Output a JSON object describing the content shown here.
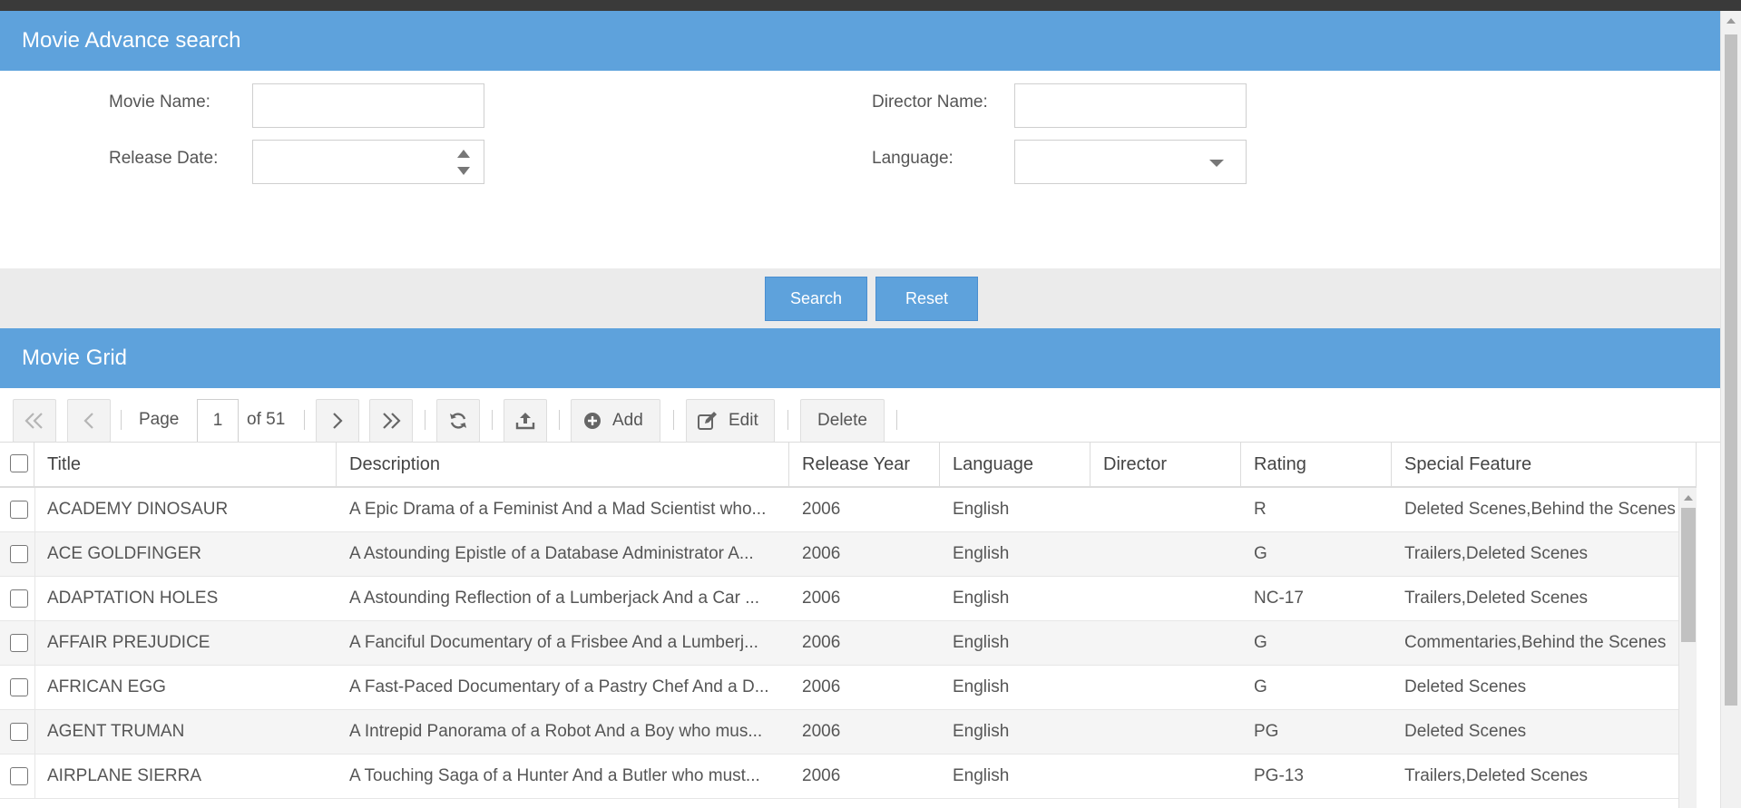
{
  "search_panel": {
    "title": "Movie Advance search",
    "movie_name_label": "Movie Name:",
    "movie_name_value": "",
    "director_name_label": "Director Name:",
    "director_name_value": "",
    "release_date_label": "Release Date:",
    "release_date_value": "",
    "language_label": "Language:",
    "language_value": "",
    "search_button": "Search",
    "reset_button": "Reset"
  },
  "grid_panel": {
    "title": "Movie Grid",
    "toolbar": {
      "page_label": "Page",
      "page_number": "1",
      "page_total": "of 51",
      "add_label": "Add",
      "edit_label": "Edit",
      "delete_label": "Delete"
    },
    "columns": [
      "Title",
      "Description",
      "Release Year",
      "Language",
      "Director",
      "Rating",
      "Special Feature"
    ],
    "rows": [
      {
        "title": "ACADEMY DINOSAUR",
        "description": "A Epic Drama of a Feminist And a Mad Scientist who...",
        "year": "2006",
        "language": "English",
        "director": "",
        "rating": "R",
        "feature": "Deleted Scenes,Behind the Scenes"
      },
      {
        "title": "ACE GOLDFINGER",
        "description": "A Astounding Epistle of a Database Administrator A...",
        "year": "2006",
        "language": "English",
        "director": "",
        "rating": "G",
        "feature": "Trailers,Deleted Scenes"
      },
      {
        "title": "ADAPTATION HOLES",
        "description": "A Astounding Reflection of a Lumberjack And a Car ...",
        "year": "2006",
        "language": "English",
        "director": "",
        "rating": "NC-17",
        "feature": "Trailers,Deleted Scenes"
      },
      {
        "title": "AFFAIR PREJUDICE",
        "description": "A Fanciful Documentary of a Frisbee And a Lumberj...",
        "year": "2006",
        "language": "English",
        "director": "",
        "rating": "G",
        "feature": "Commentaries,Behind the Scenes"
      },
      {
        "title": "AFRICAN EGG",
        "description": "A Fast-Paced Documentary of a Pastry Chef And a D...",
        "year": "2006",
        "language": "English",
        "director": "",
        "rating": "G",
        "feature": "Deleted Scenes"
      },
      {
        "title": "AGENT TRUMAN",
        "description": "A Intrepid Panorama of a Robot And a Boy who mus...",
        "year": "2006",
        "language": "English",
        "director": "",
        "rating": "PG",
        "feature": "Deleted Scenes"
      },
      {
        "title": "AIRPLANE SIERRA",
        "description": "A Touching Saga of a Hunter And a Butler who must...",
        "year": "2006",
        "language": "English",
        "director": "",
        "rating": "PG-13",
        "feature": "Trailers,Deleted Scenes"
      }
    ]
  },
  "colors": {
    "header_blue": "#5ea2dc",
    "button_bar_gray": "#ebebeb",
    "alt_row": "#f5f5f5"
  }
}
